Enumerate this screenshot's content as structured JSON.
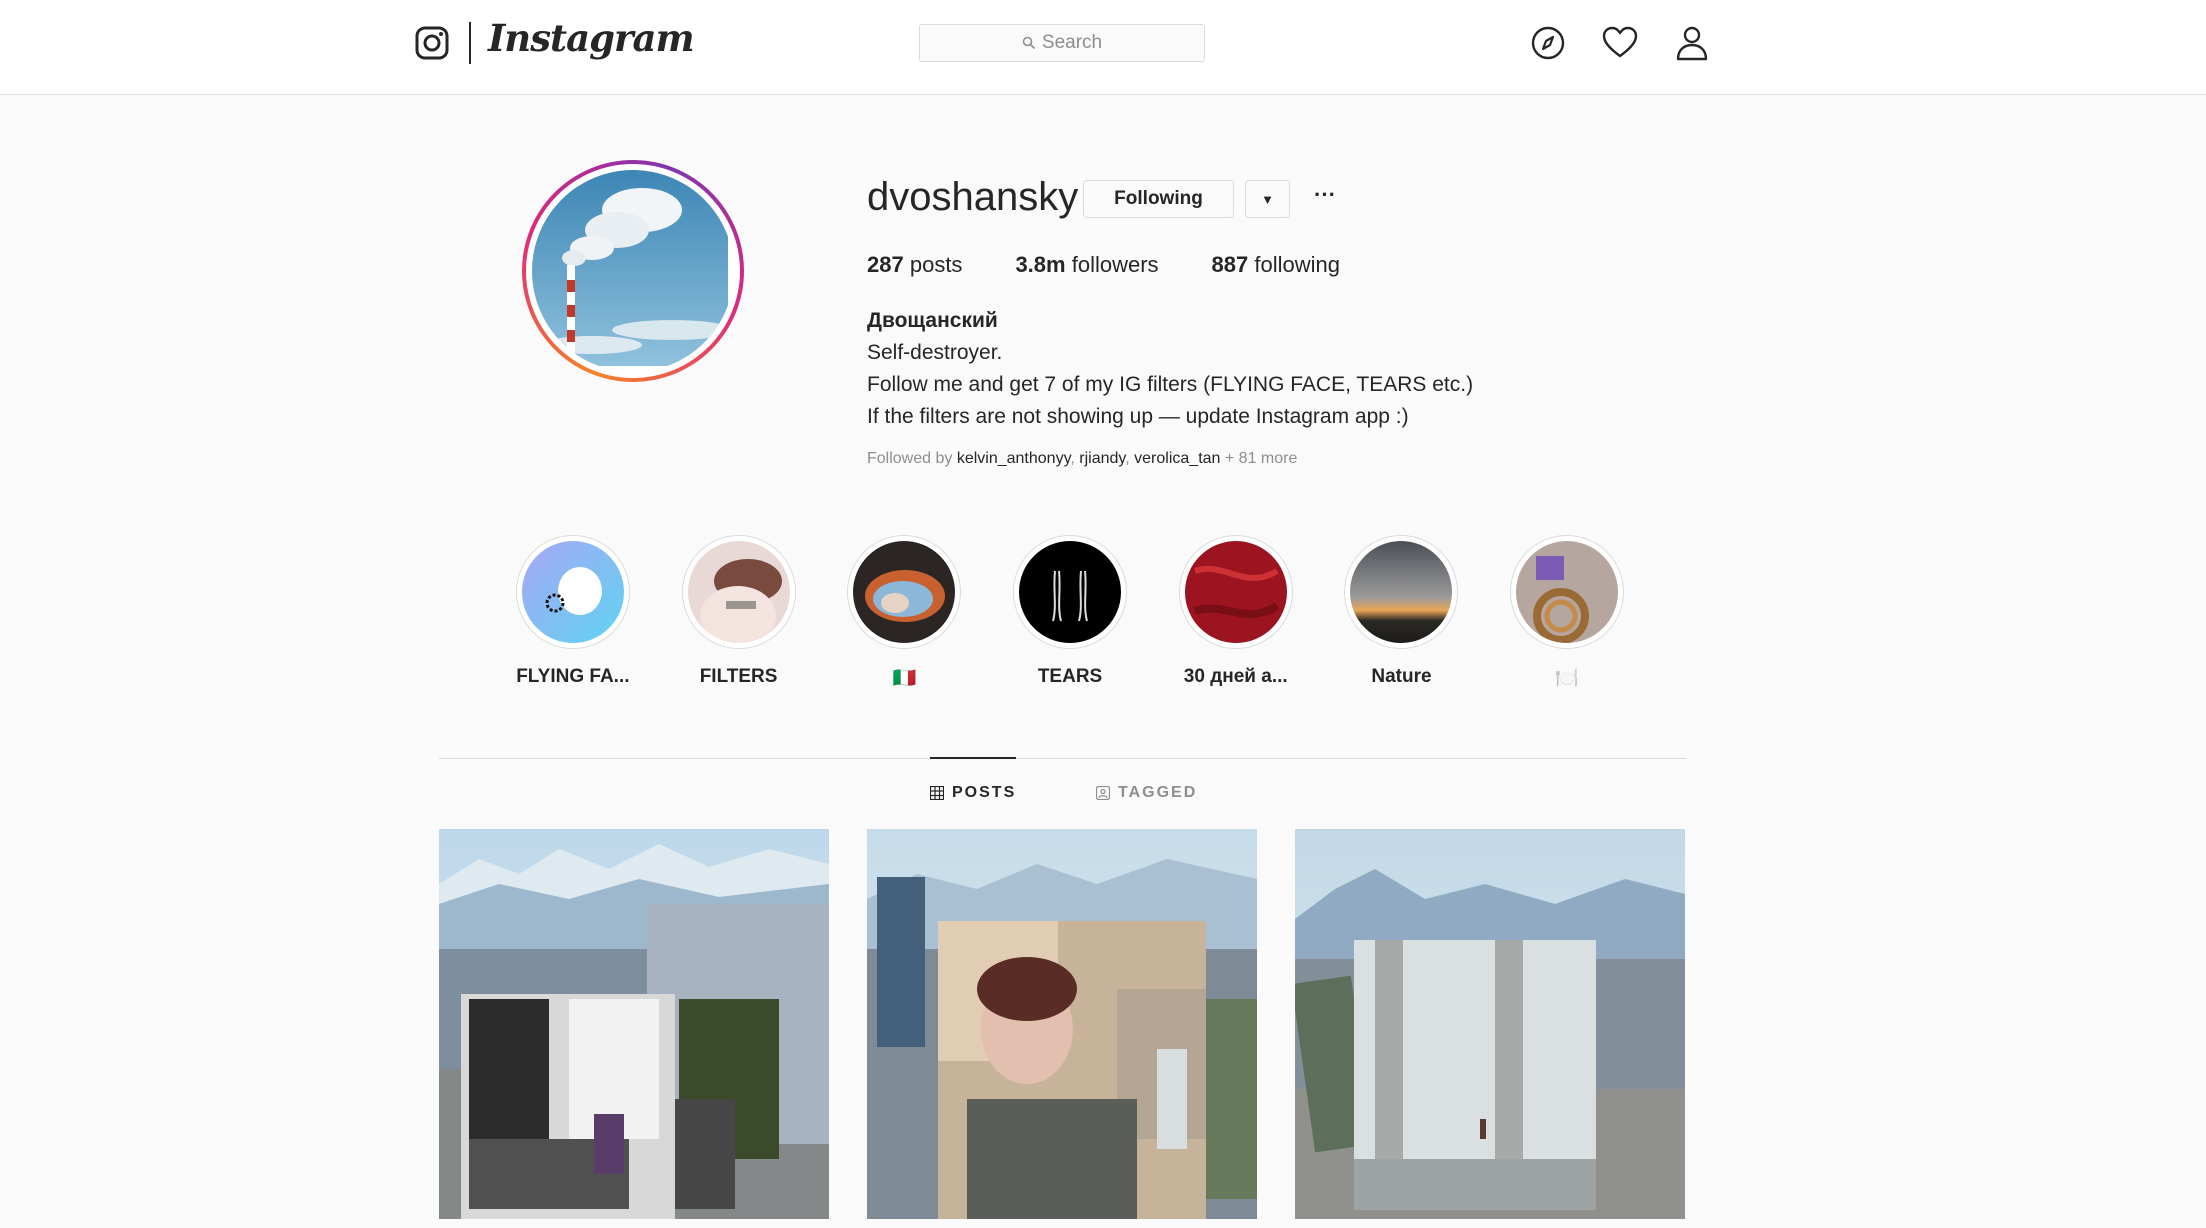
{
  "header": {
    "logo_icon": "instagram-camera-icon",
    "logo_text": "Instagram",
    "search_placeholder": "Search",
    "nav_icons": [
      "compass-icon",
      "heart-icon",
      "user-icon"
    ]
  },
  "profile": {
    "username": "dvoshansky",
    "following_button": "Following",
    "stats": {
      "posts_count": "287",
      "posts_label": "posts",
      "followers_count": "3.8m",
      "followers_label": "followers",
      "following_count": "887",
      "following_label": "following"
    },
    "full_name": "Двощанский",
    "bio_lines": [
      "Self-destroyer.",
      "Follow me and get 7 of my IG filters (FLYING FACE, TEARS etc.)",
      "If the filters are not showing up — update Instagram app :)"
    ],
    "followed_by": {
      "prefix": "Followed by",
      "user1": "kelvin_anthonyy",
      "sep1": ",",
      "user2": "rjiandy",
      "sep2": ",",
      "user3": "verolica_tan",
      "more": "+ 81 more"
    }
  },
  "highlights": [
    {
      "label": "FLYING FA..."
    },
    {
      "label": "FILTERS"
    },
    {
      "label": "🇮🇹"
    },
    {
      "label": "TEARS"
    },
    {
      "label": "30 дней а..."
    },
    {
      "label": "Nature"
    },
    {
      "label": "🍽️"
    }
  ],
  "tabs": {
    "posts": "POSTS",
    "tagged": "TAGGED"
  },
  "colors": {
    "background": "#fafafa",
    "border": "#dbdbdb",
    "text": "#262626",
    "muted": "#8e8e8e",
    "ring_gradient": [
      "#f58529",
      "#dd2a7b",
      "#8134af"
    ]
  }
}
